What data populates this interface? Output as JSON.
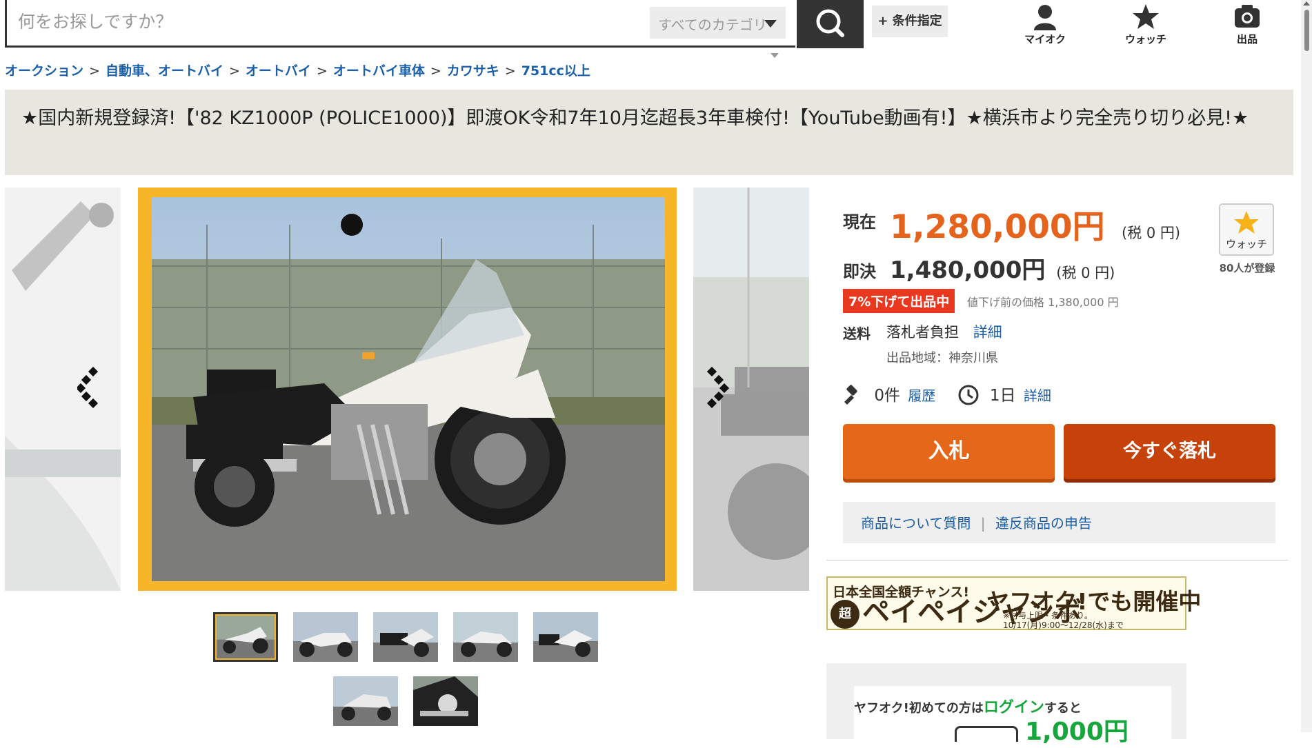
{
  "header": {
    "search_placeholder": "何をお探しですか？",
    "category_label": "すべてのカテゴリ",
    "condition_label": "+ 条件指定",
    "nav": [
      {
        "label": "マイオク",
        "icon": "user-icon"
      },
      {
        "label": "ウォッチ",
        "icon": "star-icon"
      },
      {
        "label": "出品",
        "icon": "camera-icon"
      }
    ]
  },
  "breadcrumb": [
    "オークション",
    "自動車、オートバイ",
    "オートバイ",
    "オートバイ車体",
    "カワサキ",
    "751cc以上"
  ],
  "listing": {
    "title": "★国内新規登録済!【'82 KZ1000P (POLICE1000)】即渡OK令和7年10月迄超長3年車検付!【YouTube動画有!】★横浜市より完全売り切り必見!★"
  },
  "gallery": {
    "thumbnail_count": 7,
    "selected_index": 0
  },
  "price": {
    "current_label": "現在",
    "current_value": "1,280,000円",
    "current_tax": "(税 0 円)",
    "buynow_label": "即決",
    "buynow_value": "1,480,000円",
    "buynow_tax": "(税 0 円)",
    "discount_badge": "7%下げて出品中",
    "original_price": "値下げ前の価格 1,380,000 円"
  },
  "shipping": {
    "label": "送料",
    "value": "落札者負担",
    "detail_link": "詳細",
    "region": "出品地域：神奈川県"
  },
  "bids": {
    "count": "0件",
    "history_link": "履歴",
    "time_left": "1日",
    "time_detail_link": "詳細"
  },
  "watch": {
    "label": "ウォッチ",
    "count": "80人が登録"
  },
  "actions": {
    "bid_label": "入札",
    "buynow_label": "今すぐ落札",
    "question_link": "商品について質問",
    "report_link": "違反商品の申告"
  },
  "banner": {
    "line1": "日本全国全額チャンス!",
    "chou": "超",
    "jumbo": "ペイペイジャンボ",
    "right_big": "ヤフオク!でも開催中",
    "right_small_1": "※付与上限・条件あり。",
    "right_small_2": "10/17(月)9:00〜12/28(水)まで"
  },
  "login_promo": {
    "text_before": "ヤフオク!初めての方は",
    "text_link": "ログイン",
    "text_after": "すると",
    "amount_peek": "1,000円"
  },
  "colors": {
    "accent_orange": "#e4641e",
    "bid_button": "#e5671a",
    "buynow_button": "#c6420a",
    "discount_red": "#e83820",
    "link_blue": "#1a5fa8",
    "frame_yellow": "#f7b52a"
  }
}
